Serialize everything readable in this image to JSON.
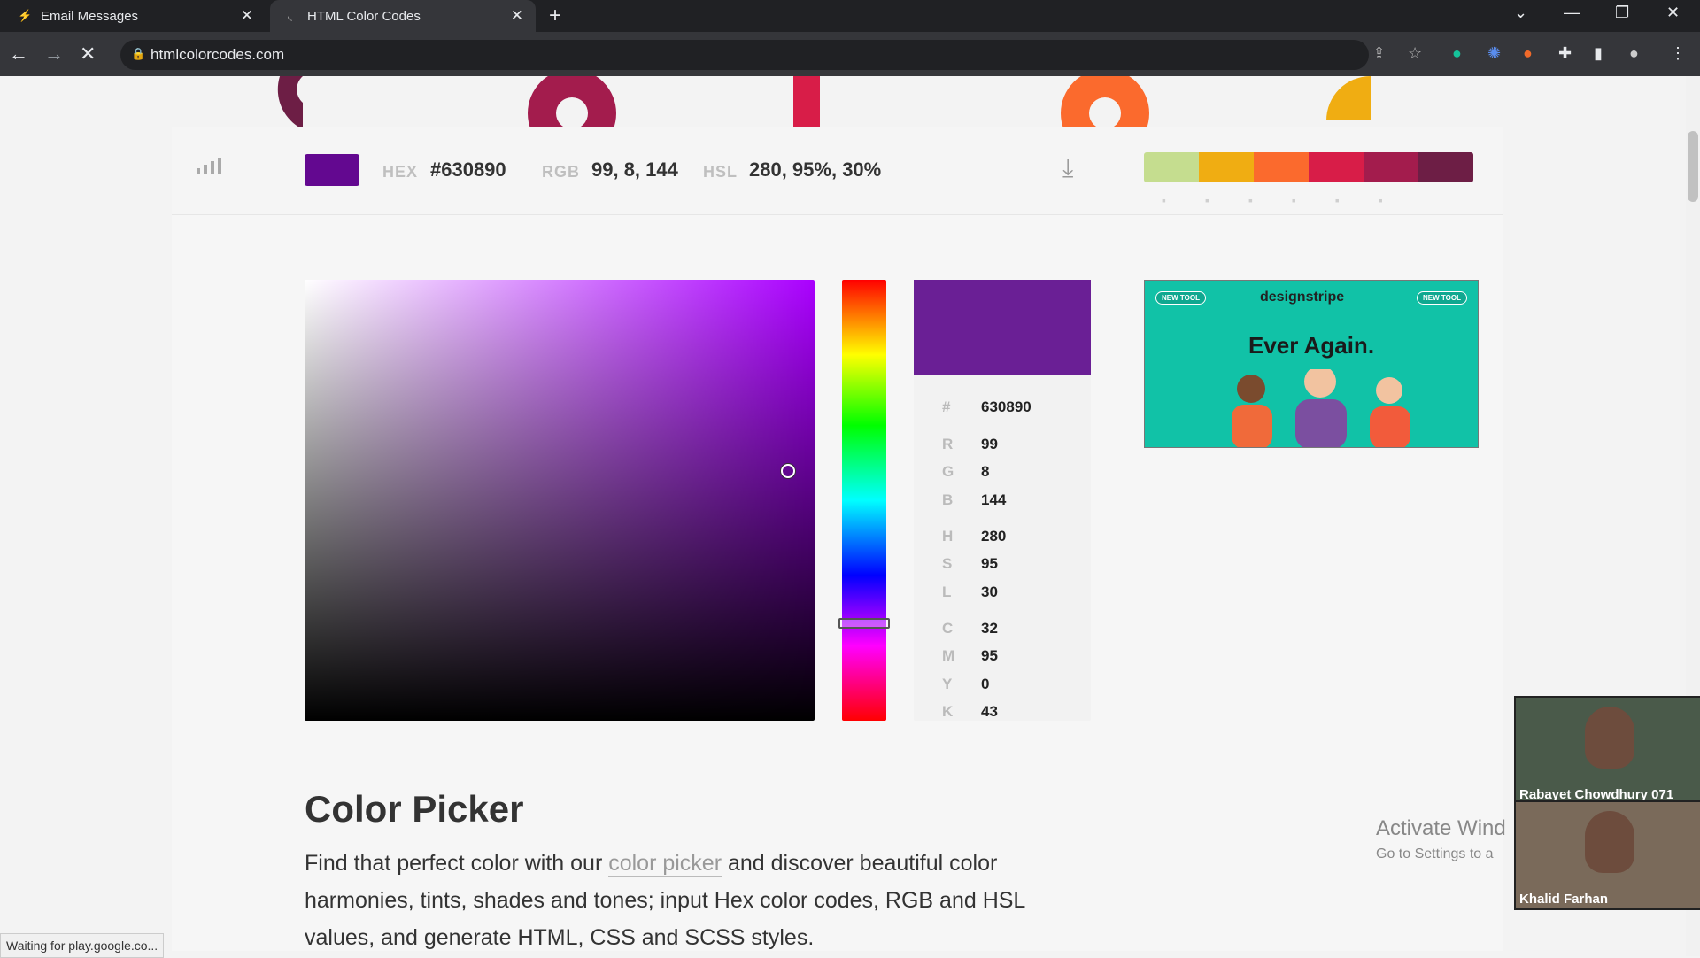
{
  "browser": {
    "tabs": [
      {
        "label": "Email Messages",
        "active": false
      },
      {
        "label": "HTML Color Codes",
        "active": true
      }
    ],
    "url": "htmlcolorcodes.com",
    "status": "Waiting for play.google.co..."
  },
  "color_bar": {
    "hex_label": "HEX",
    "hex_value": "#630890",
    "rgb_label": "RGB",
    "rgb_value": "99, 8, 144",
    "hsl_label": "HSL",
    "hsl_value": "280, 95%, 30%",
    "swatch_color": "#630890",
    "palette": [
      "#c5dd8f",
      "#f0ad12",
      "#fb6a2d",
      "#d81d48",
      "#a31c4d",
      "#6d1e45"
    ]
  },
  "values_panel": {
    "preview_color": "#6a1f95",
    "hex_symbol": "#",
    "hex": "630890",
    "r_label": "R",
    "r": "99",
    "g_label": "G",
    "g": "8",
    "b_label": "B",
    "b": "144",
    "h_label": "H",
    "h": "280",
    "s_label": "S",
    "s": "95",
    "l_label": "L",
    "l": "30",
    "c_label": "C",
    "c": "32",
    "m_label": "M",
    "m": "95",
    "y_label": "Y",
    "y": "0",
    "k_label": "K",
    "k": "43"
  },
  "ad": {
    "tag_left": "NEW TOOL",
    "tag_right": "NEW TOOL",
    "brand": "designstripe",
    "headline": "Ever Again."
  },
  "content": {
    "title": "Color Picker",
    "para_1": "Find that perfect color with our ",
    "link": "color picker",
    "para_2": " and discover beautiful color harmonies, tints, shades and tones; input Hex color codes, RGB and HSL values, and generate HTML, CSS and SCSS styles."
  },
  "overlay": {
    "watermark_title": "Activate Wind",
    "watermark_sub": "Go to Settings to a",
    "participant_1": "Rabayet Chowdhury 071",
    "participant_2": "Khalid Farhan"
  }
}
